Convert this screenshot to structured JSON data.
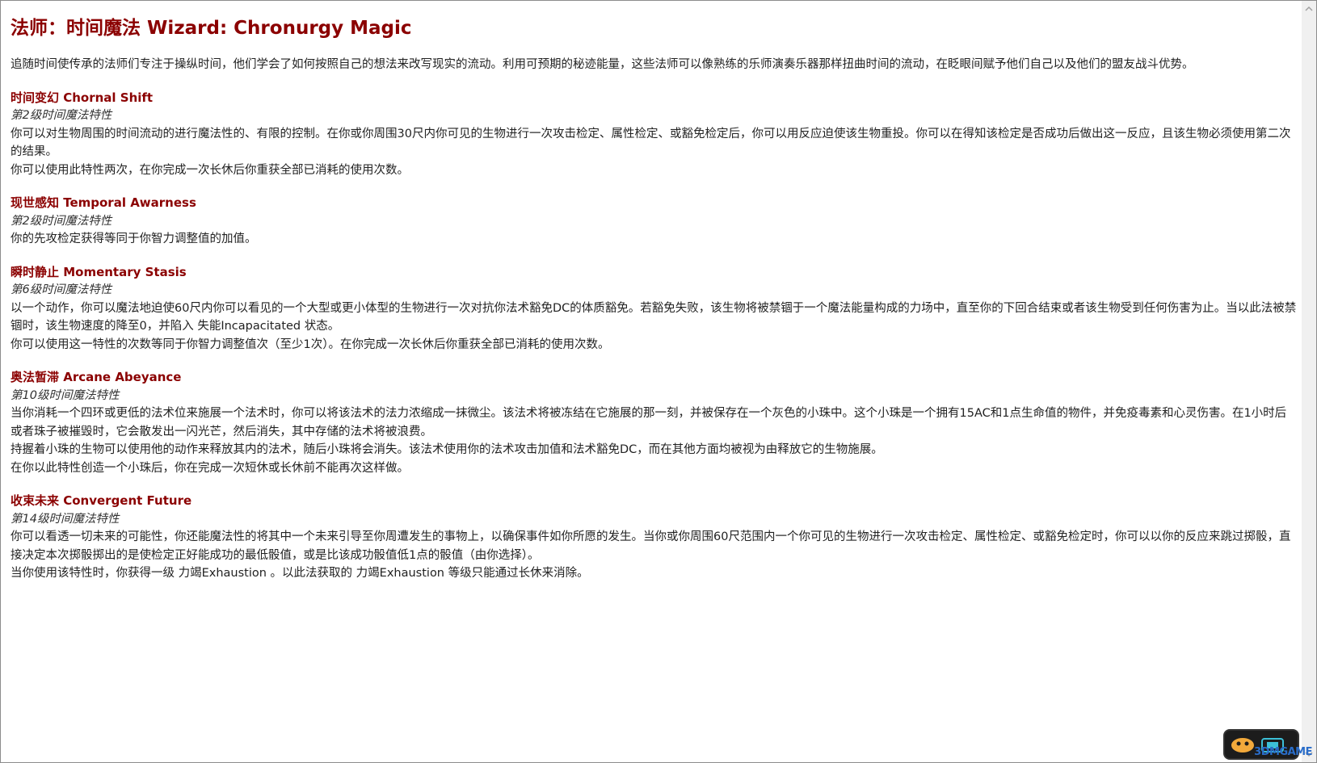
{
  "page": {
    "title": "法师：时间魔法 Wizard: Chronurgy Magic",
    "intro": "追随时间使传承的法师们专注于操纵时间，他们学会了如何按照自己的想法来改写现实的流动。利用可预期的秘迹能量，这些法师可以像熟练的乐师演奏乐器那样扭曲时间的流动，在眨眼间赋予他们自己以及他们的盟友战斗优势。"
  },
  "sections": [
    {
      "title": "时间变幻 Chornal Shift",
      "level": "第2级时间魔法特性",
      "paragraphs": [
        "你可以对生物周围的时间流动的进行魔法性的、有限的控制。在你或你周围30尺内你可见的生物进行一次攻击检定、属性检定、或豁免检定后，你可以用反应迫使该生物重投。你可以在得知该检定是否成功后做出这一反应，且该生物必须使用第二次的结果。",
        "你可以使用此特性两次，在你完成一次长休后你重获全部已消耗的使用次数。"
      ]
    },
    {
      "title": "现世感知 Temporal Awarness",
      "level": "第2级时间魔法特性",
      "paragraphs": [
        "你的先攻检定获得等同于你智力调整值的加值。"
      ]
    },
    {
      "title": "瞬时静止 Momentary Stasis",
      "level": "第6级时间魔法特性",
      "paragraphs": [
        "以一个动作，你可以魔法地迫使60尺内你可以看见的一个大型或更小体型的生物进行一次对抗你法术豁免DC的体质豁免。若豁免失败，该生物将被禁锢于一个魔法能量构成的力场中，直至你的下回合结束或者该生物受到任何伤害为止。当以此法被禁锢时，该生物速度的降至0，并陷入 失能Incapacitated 状态。",
        "你可以使用这一特性的次数等同于你智力调整值次（至少1次）。在你完成一次长休后你重获全部已消耗的使用次数。"
      ]
    },
    {
      "title": "奥法暂滞 Arcane Abeyance",
      "level": "第10级时间魔法特性",
      "paragraphs": [
        "当你消耗一个四环或更低的法术位来施展一个法术时，你可以将该法术的法力浓缩成一抹微尘。该法术将被冻结在它施展的那一刻，并被保存在一个灰色的小珠中。这个小珠是一个拥有15AC和1点生命值的物件，并免疫毒素和心灵伤害。在1小时后或者珠子被摧毁时，它会散发出一闪光芒，然后消失，其中存储的法术将被浪费。",
        "持握着小珠的生物可以使用他的动作来释放其内的法术，随后小珠将会消失。该法术使用你的法术攻击加值和法术豁免DC，而在其他方面均被视为由释放它的生物施展。",
        "在你以此特性创造一个小珠后，你在完成一次短休或长休前不能再次这样做。"
      ]
    },
    {
      "title": "收束未来 Convergent Future",
      "level": "第14级时间魔法特性",
      "paragraphs": [
        "你可以看透一切未来的可能性，你还能魔法性的将其中一个未来引导至你周遭发生的事物上，以确保事件如你所愿的发生。当你或你周围60尺范围内一个你可见的生物进行一次攻击检定、属性检定、或豁免检定时，你可以以你的反应来跳过掷骰，直接决定本次掷骰掷出的是使检定正好能成功的最低骰值，或是比该成功骰值低1点的骰值（由你选择）。",
        "当你使用该特性时，你获得一级 力竭Exhaustion 。以此法获取的 力竭Exhaustion 等级只能通过长休来消除。"
      ]
    }
  ],
  "watermark": {
    "text": "3DMGAME"
  },
  "icons": {
    "scroll_up": "chevron-up-icon",
    "scroll_down": "chevron-down-icon",
    "watermark_logo": "3dm-logo-icon"
  }
}
